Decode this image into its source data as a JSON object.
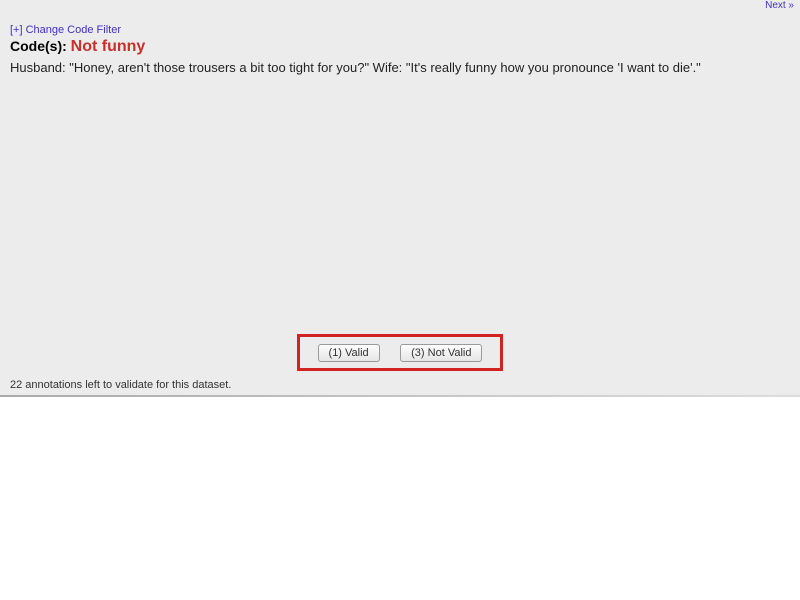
{
  "nav": {
    "next": "Next »"
  },
  "filter_link": "[+] Change Code Filter",
  "codes": {
    "label": "Code(s):",
    "value": "Not funny"
  },
  "content_text": "Husband: \"Honey, aren't those trousers a bit too tight for you?\" Wife: \"It's really funny how you pronounce 'I want to die'.\"",
  "buttons": {
    "valid": "(1) Valid",
    "not_valid": "(3) Not Valid"
  },
  "status": "22 annotations left to validate for this dataset."
}
